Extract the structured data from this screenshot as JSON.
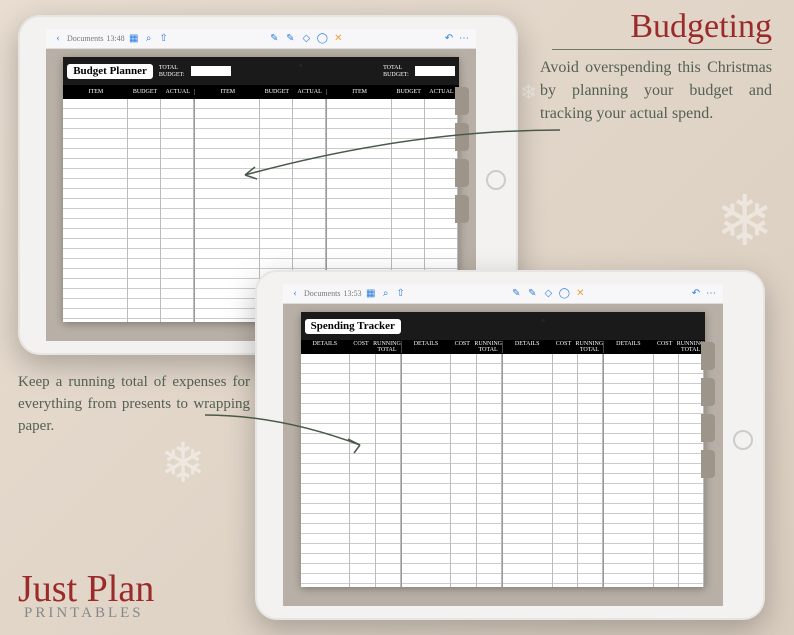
{
  "heading": "Budgeting",
  "callout_right": "Avoid overspending this Christmas by planning your budget and tracking your actual spend.",
  "callout_left": "Keep a running total of expenses for everything from presents to wrapping paper.",
  "brand": {
    "line1": "Just Plan",
    "line2": "Printables"
  },
  "ipad1": {
    "toolbar": {
      "back_label": "Documents",
      "time": "13:48"
    },
    "page": {
      "title": "Budget Planner",
      "sub1": "TOTAL",
      "sub2": "BUDGET:",
      "columns": {
        "item": "ITEM",
        "budget": "BUDGET",
        "actual": "ACTUAL"
      }
    }
  },
  "ipad2": {
    "toolbar": {
      "back_label": "Documents",
      "time": "13:53"
    },
    "page": {
      "title": "Spending Tracker",
      "columns": {
        "details": "DETAILS",
        "cost": "COST",
        "running": "RUNNING TOTAL"
      }
    }
  }
}
